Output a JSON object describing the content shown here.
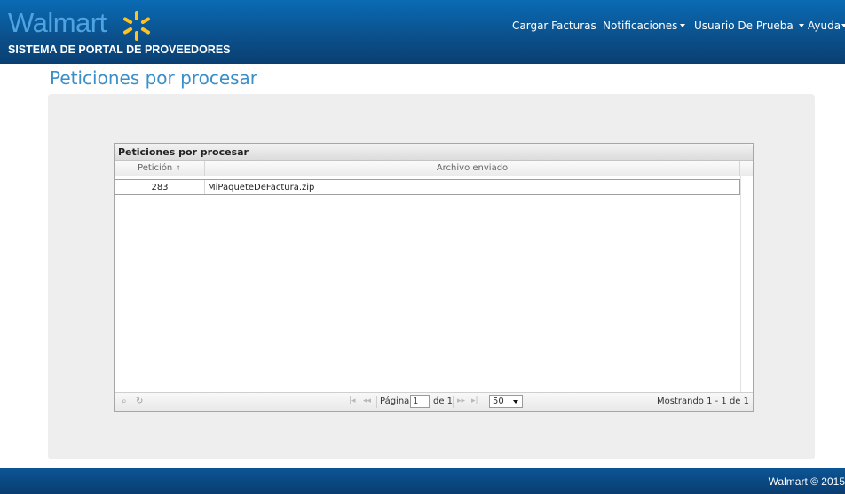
{
  "header": {
    "brand": "Walmart",
    "system_title": "SISTEMA DE PORTAL DE PROVEEDORES",
    "nav": {
      "upload": "Cargar Facturas",
      "notifications": "Notificaciones",
      "user": "Usuario De Prueba",
      "help": "Ayuda"
    },
    "brand_colors": {
      "navbar": "#0b4f8a",
      "spark": "#ffc220",
      "wordmark": "#4ea4e0"
    }
  },
  "page": {
    "title": "Peticiones por procesar"
  },
  "grid": {
    "caption": "Peticiones por procesar",
    "columns": [
      "Petición",
      "Archivo enviado"
    ],
    "rows": [
      {
        "peticion": "283",
        "archivo": "MiPaqueteDeFactura.zip"
      }
    ],
    "pager": {
      "search_icon": "search-icon",
      "refresh_icon": "refresh-icon",
      "page_label": "Página",
      "page_value": "1",
      "of_label": "de 1",
      "page_size": "50",
      "status": "Mostrando 1 - 1 de 1"
    }
  },
  "footer": {
    "text": "Walmart © 2015"
  }
}
